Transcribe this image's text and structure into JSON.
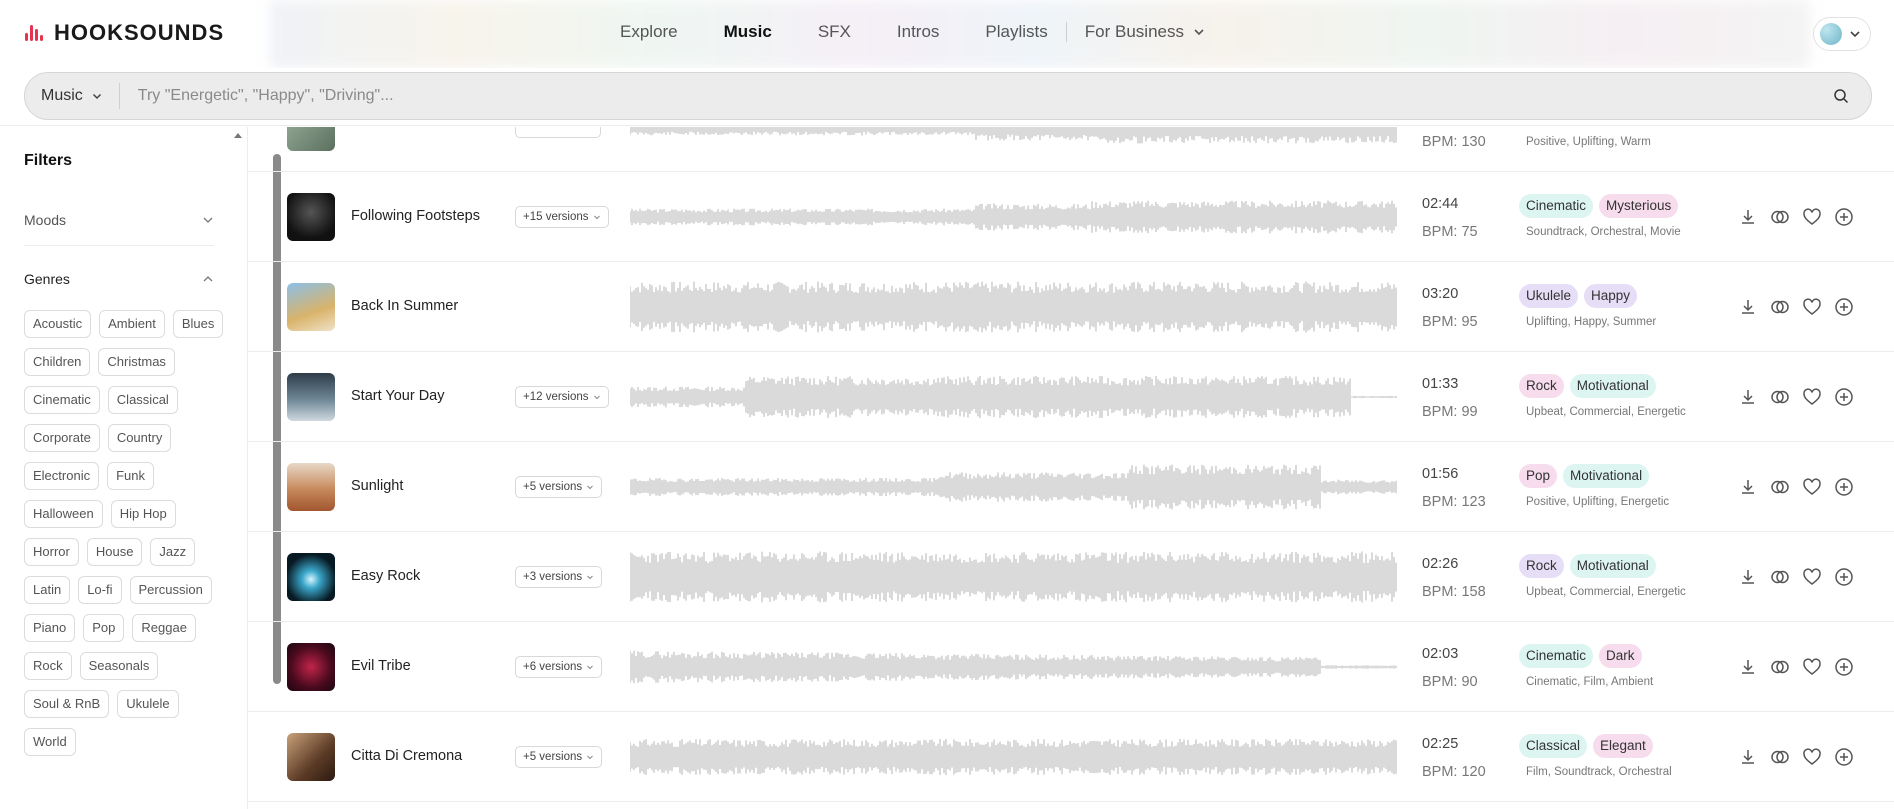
{
  "brand": {
    "name": "HOOKSOUNDS"
  },
  "nav": {
    "items": [
      "Explore",
      "Music",
      "SFX",
      "Intros",
      "Playlists"
    ],
    "active": "Music",
    "business": "For Business"
  },
  "search": {
    "type_label": "Music",
    "placeholder": "Try \"Energetic\", \"Happy\", \"Driving\"..."
  },
  "sidebar": {
    "title": "Filters",
    "moods_label": "Moods",
    "genres_label": "Genres",
    "genres": [
      "Acoustic",
      "Ambient",
      "Blues",
      "Children",
      "Christmas",
      "Cinematic",
      "Classical",
      "Corporate",
      "Country",
      "Electronic",
      "Funk",
      "Halloween",
      "Hip Hop",
      "Horror",
      "House",
      "Jazz",
      "Latin",
      "Lo-fi",
      "Percussion",
      "Piano",
      "Pop",
      "Reggae",
      "Rock",
      "Seasonals",
      "Soul & RnB",
      "Ukulele",
      "World"
    ]
  },
  "colors": {
    "accent": "#e8334e",
    "tag_mint": "#dcf5f1",
    "tag_pink": "#f6dcec",
    "tag_lavender": "#e6def6",
    "waveform": "#d0d0d0"
  },
  "partial_track": {
    "bpm": "BPM: 130",
    "subtags": "Positive, Uplifting, Warm"
  },
  "tracks": [
    {
      "title": "Following Footsteps",
      "versions": "+15 versions",
      "duration": "02:44",
      "bpm": "BPM: 75",
      "tags": [
        "Cinematic",
        "Mysterious"
      ],
      "tag_colors": [
        "mint",
        "pink"
      ],
      "subtags": "Soundtrack, Orchestral, Movie"
    },
    {
      "title": "Back In Summer",
      "versions": "",
      "duration": "03:20",
      "bpm": "BPM: 95",
      "tags": [
        "Ukulele",
        "Happy"
      ],
      "tag_colors": [
        "lavender",
        "lavender"
      ],
      "subtags": "Uplifting, Happy, Summer"
    },
    {
      "title": "Start Your Day",
      "versions": "+12 versions",
      "duration": "01:33",
      "bpm": "BPM: 99",
      "tags": [
        "Rock",
        "Motivational"
      ],
      "tag_colors": [
        "pink",
        "mint"
      ],
      "subtags": "Upbeat, Commercial, Energetic"
    },
    {
      "title": "Sunlight",
      "versions": "+5 versions",
      "duration": "01:56",
      "bpm": "BPM: 123",
      "tags": [
        "Pop",
        "Motivational"
      ],
      "tag_colors": [
        "pink",
        "mint"
      ],
      "subtags": "Positive, Uplifting, Energetic"
    },
    {
      "title": "Easy Rock",
      "versions": "+3 versions",
      "duration": "02:26",
      "bpm": "BPM: 158",
      "tags": [
        "Rock",
        "Motivational"
      ],
      "tag_colors": [
        "lavender",
        "mint"
      ],
      "subtags": "Upbeat, Commercial, Energetic"
    },
    {
      "title": "Evil Tribe",
      "versions": "+6 versions",
      "duration": "02:03",
      "bpm": "BPM: 90",
      "tags": [
        "Cinematic",
        "Dark"
      ],
      "tag_colors": [
        "mint",
        "pink"
      ],
      "subtags": "Cinematic, Film, Ambient"
    },
    {
      "title": "Citta Di Cremona",
      "versions": "+5 versions",
      "duration": "02:25",
      "bpm": "BPM: 120",
      "tags": [
        "Classical",
        "Elegant"
      ],
      "tag_colors": [
        "mint",
        "pink"
      ],
      "subtags": "Film, Soundtrack, Orchestral"
    }
  ]
}
